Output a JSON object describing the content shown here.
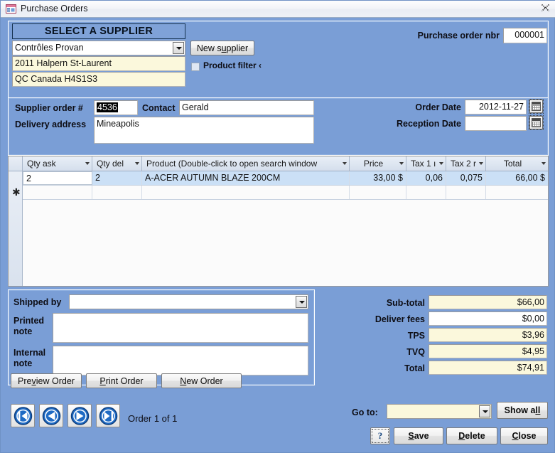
{
  "window": {
    "title": "Purchase Orders",
    "icon": "access-form-icon",
    "close_label": "⌧"
  },
  "supplier_section": {
    "header": "SELECT A SUPPLIER",
    "supplier_combo_value": "Contrôles Provan",
    "address_line1": "2011 Halpern  St-Laurent",
    "address_line2": "QC  Canada  H4S1S3",
    "new_supplier_button": "New supplier",
    "new_supplier_accel": "u",
    "product_filter_label": "Product filter ‹",
    "product_filter_checked": false,
    "purchase_order_nbr_label": "Purchase order nbr",
    "purchase_order_nbr_value": "000001"
  },
  "order_section": {
    "supplier_order_label": "Supplier order #",
    "supplier_order_value": "4536",
    "supplier_order_selected": true,
    "contact_label": "Contact",
    "contact_value": "Gerald",
    "delivery_address_label": "Delivery address",
    "delivery_address_value": "Mineapolis",
    "order_date_label": "Order Date",
    "order_date_value": "2012-11-27",
    "reception_date_label": "Reception Date",
    "reception_date_value": "",
    "calendar_icon": "calendar-icon"
  },
  "grid": {
    "columns": [
      {
        "label": "Qty ask",
        "align": "left"
      },
      {
        "label": "Qty del",
        "align": "left"
      },
      {
        "label": "Product (Double-click to open search window",
        "align": "left"
      },
      {
        "label": "Price",
        "align": "center"
      },
      {
        "label": "Tax 1 ı",
        "align": "left"
      },
      {
        "label": "Tax 2 r",
        "align": "left"
      },
      {
        "label": "Total",
        "align": "center"
      }
    ],
    "rows": [
      {
        "selected": true,
        "cells": [
          {
            "value": "2",
            "align": "left",
            "focused": true
          },
          {
            "value": "2",
            "align": "left"
          },
          {
            "value": "A-ACER AUTUMN BLAZE 200CM",
            "align": "left"
          },
          {
            "value": "33,00 $",
            "align": "right"
          },
          {
            "value": "0,06",
            "align": "right"
          },
          {
            "value": "0,075",
            "align": "right"
          },
          {
            "value": "66,00 $",
            "align": "right"
          }
        ]
      }
    ],
    "new_row_marker": "✱"
  },
  "notes_section": {
    "shipped_by_label": "Shipped by",
    "shipped_by_value": "",
    "printed_note_label": "Printed\nnote",
    "printed_note_label_l1": "Printed",
    "printed_note_label_l2": "note",
    "printed_note_value": "",
    "internal_note_label_l1": "Internal",
    "internal_note_label_l2": "note",
    "internal_note_value": ""
  },
  "totals": [
    {
      "label": "Sub-total",
      "value": "$66,00",
      "editable": false
    },
    {
      "label": "Deliver fees",
      "value": "$0,00",
      "editable": true
    },
    {
      "label": "TPS",
      "value": "$3,96",
      "editable": false
    },
    {
      "label": "TVQ",
      "value": "$4,95",
      "editable": false
    },
    {
      "label": "Total",
      "value": "$74,91",
      "editable": false
    }
  ],
  "action_buttons": [
    {
      "label": "Preview Order",
      "accel": "v"
    },
    {
      "label": "Print Order",
      "accel": "P"
    },
    {
      "label": "New Order",
      "accel": "N"
    }
  ],
  "navigation": {
    "first_icon": "first-record-icon",
    "prev_icon": "previous-record-icon",
    "next_icon": "next-record-icon",
    "last_icon": "last-record-icon",
    "record_status": "Order 1 of 1"
  },
  "footer": {
    "goto_label": "Go to:",
    "goto_value": "",
    "show_all_label": "Show all",
    "show_all_accel": "ll",
    "help_label": "?",
    "save_label": "Save",
    "delete_label": "Delete",
    "close_label": "Close"
  },
  "colors": {
    "form_background": "#7a9ed6",
    "section_header": "#7fa2d8",
    "yellow_field": "#fbf8dc",
    "row_selected": "#cbe0f6",
    "nav_icon_blue": "#1f6bc4"
  }
}
